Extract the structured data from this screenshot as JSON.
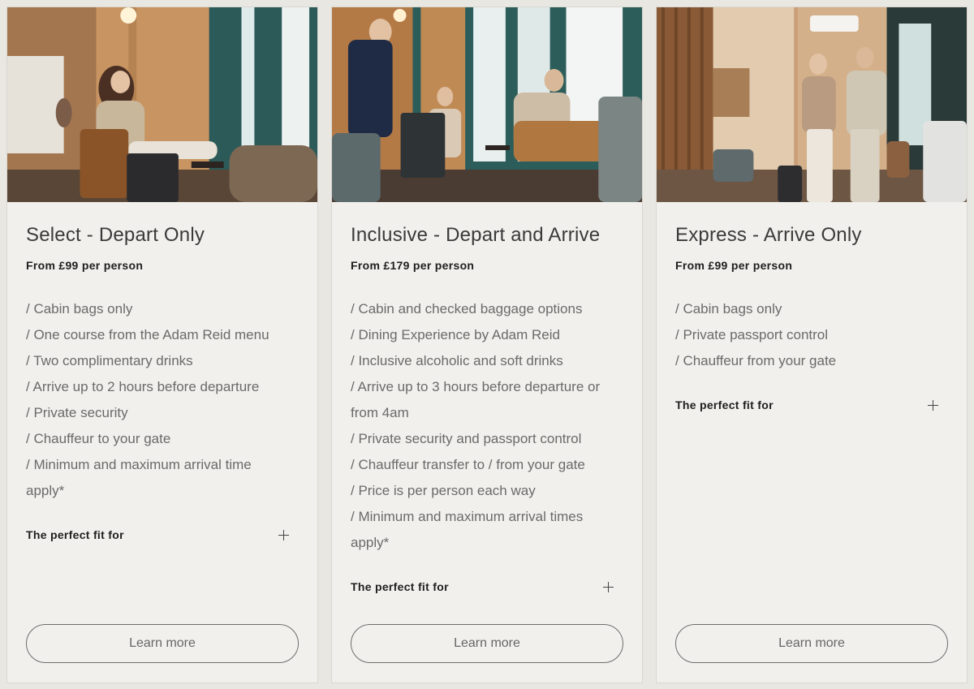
{
  "cards": [
    {
      "title": "Select - Depart Only",
      "price": "From £99 per person",
      "features": [
        "/ Cabin bags only",
        "/ One course from the Adam Reid menu",
        "/ Two complimentary drinks",
        "/ Arrive up to 2 hours before departure",
        "/ Private security",
        "/ Chauffeur to your gate",
        "/ Minimum and maximum arrival time",
        "apply*"
      ],
      "fit_label": "The perfect fit for",
      "button_label": "Learn more"
    },
    {
      "title": "Inclusive - Depart and Arrive",
      "price": "From £179 per person",
      "features": [
        "/ Cabin and checked baggage options",
        "/ Dining Experience by Adam Reid",
        "/ Inclusive alcoholic and soft drinks",
        "/ Arrive up to 3 hours before departure or",
        "from 4am",
        "/ Private security and passport control",
        "/ Chauffeur transfer to / from your gate",
        "/ Price is per person each way",
        "/ Minimum and maximum arrival times",
        "apply*"
      ],
      "fit_label": "The perfect fit for",
      "button_label": "Learn more"
    },
    {
      "title": "Express - Arrive Only",
      "price": "From £99 per person",
      "features": [
        "/ Cabin bags only",
        "/ Private passport control",
        "/ Chauffeur from your gate"
      ],
      "fit_label": "The perfect fit for",
      "button_label": "Learn more"
    }
  ],
  "icons": {
    "expand": "plus-icon"
  },
  "colors": {
    "page_background": "#e9e7e2",
    "card_background": "#f1f0ec",
    "wood": "#c8955f",
    "window_teal": "#2c5a58"
  }
}
